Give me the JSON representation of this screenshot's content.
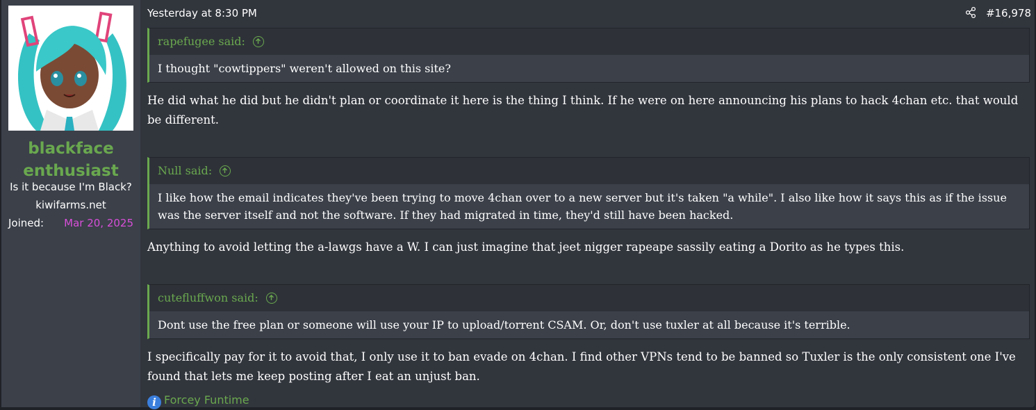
{
  "user": {
    "name_line1": "blackface",
    "name_line2": "enthusiast",
    "title": "Is it because I'm Black?",
    "site": "kiwifarms.net",
    "joined_label": "Joined:",
    "joined_date": "Mar 20, 2025"
  },
  "post": {
    "timestamp": "Yesterday at 8:30 PM",
    "number": "#16,978",
    "quotes": [
      {
        "author": "rapefugee said:",
        "text": "I thought \"cowtippers\" weren't allowed on this site?"
      },
      {
        "author": "Null said:",
        "text": "I like how the email indicates they've been trying to move 4chan over to a new server but it's taken \"a while\". I also like how it says this as if the issue was the server itself and not the software. If they had migrated in time, they'd still have been hacked."
      },
      {
        "author": "cutefluffwon said:",
        "text": "Dont use the free plan or someone will use your IP to upload/torrent CSAM. Or, don't use tuxler at all because it's terrible."
      }
    ],
    "paragraphs": [
      "He did what he did but he didn't plan or coordinate it here is the thing I think. If he were on here announcing his plans to hack 4chan etc. that would be different.",
      "Anything to avoid letting the a-lawgs have a W. I can just imagine that jeet nigger rapeape sassily eating a Dorito as he types this.",
      "I specifically pay for it to avoid that, I only use it to ban evade on 4chan. I find other VPNs tend to be banned so Tuxler is the only consistent one I've found that lets me keep posting after I eat an unjust ban."
    ],
    "signature": "Forcey Funtime"
  },
  "icons": {
    "share": "share-icon",
    "quote_jump": "arrow-up-circle-icon",
    "info": "info-icon"
  },
  "colors": {
    "username": "#6aa84f",
    "joined_date": "#d84fd8",
    "quote_border": "#6aa84f"
  }
}
